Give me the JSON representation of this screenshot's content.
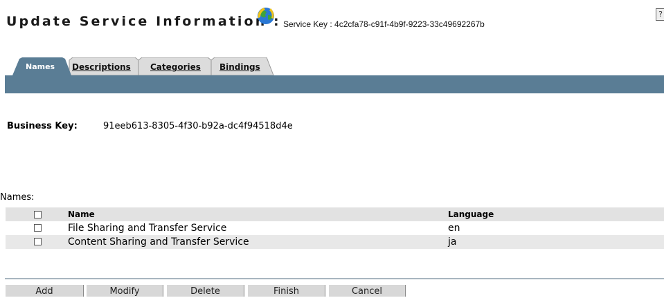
{
  "header": {
    "title": "Update Service Information :",
    "service_key_label": "Service Key : 4c2cfa78-c91f-4b9f-9223-33c49692267b",
    "help_glyph": "?"
  },
  "tabs": [
    {
      "label": "Names",
      "active": true
    },
    {
      "label": "Descriptions",
      "active": false
    },
    {
      "label": "Categories",
      "active": false
    },
    {
      "label": "Bindings",
      "active": false
    }
  ],
  "business": {
    "label": "Business Key:",
    "value": "91eeb613-8305-4f30-b92a-dc4f94518d4e"
  },
  "names_section": {
    "label": "Names:",
    "columns": {
      "name": "Name",
      "language": "Language"
    },
    "rows": [
      {
        "name": "File Sharing and Transfer Service",
        "language": "en"
      },
      {
        "name": "Content Sharing and Transfer Service",
        "language": "ja"
      }
    ]
  },
  "buttons": {
    "add": "Add",
    "modify": "Modify",
    "delete": "Delete",
    "finish": "Finish",
    "cancel": "Cancel"
  },
  "colors": {
    "tab_band": "#5a7d95",
    "active_tab": "#5a7d95",
    "inactive_tab": "#dcdcdc",
    "button_bg": "#d8d8d8"
  }
}
